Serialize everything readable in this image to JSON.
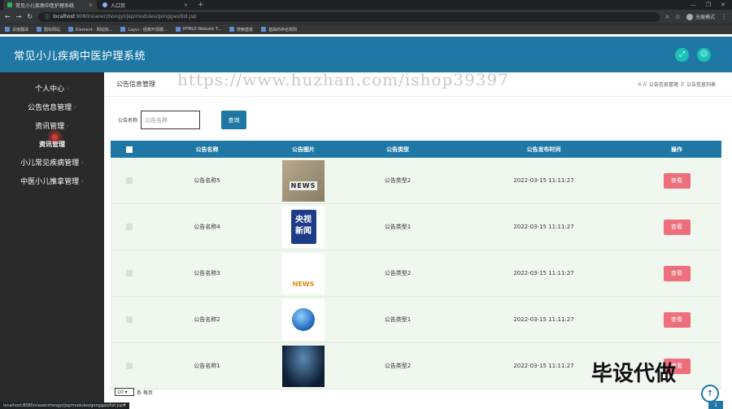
{
  "browser": {
    "tabs": [
      {
        "title": "常见小儿疾病中医护理系统",
        "close": "×"
      },
      {
        "title": "入口页",
        "close": "×"
      }
    ],
    "new_tab": "+",
    "url_host": "localhost",
    "url_path": ":8080/xiaoerzhongyi/jsp/modules/gonggao/list.jsp",
    "profile": "无痕模式",
    "bookmarks": [
      "百度翻译",
      "图标网站",
      "Element - 网站快...",
      "Layui - 经典开源模...",
      "HTML5 Website T...",
      "搜索壁纸",
      "基础的命名规则"
    ],
    "status_url": "localhost:8080/xiaoerzhongyi/jsp/modules/gonggao/list.jsp#"
  },
  "app": {
    "title": "常见小儿疾病中医护理系统",
    "header_icons": [
      "fullscreen-icon",
      "user-icon"
    ]
  },
  "sidebar": {
    "items": [
      {
        "label": "个人中心",
        "caret": "›"
      },
      {
        "label": "公告信息管理",
        "caret": "›"
      },
      {
        "label": "资讯管理",
        "caret": "›"
      },
      {
        "label": "资讯管理",
        "sub": true
      },
      {
        "label": "小儿常见疾病管理",
        "caret": "›"
      },
      {
        "label": "中医小儿推拿管理",
        "caret": "›"
      }
    ]
  },
  "main": {
    "page_title": "公告信息管理",
    "breadcrumb": {
      "home_icon": "⌂",
      "sep": "//",
      "level1": "公告信息管理",
      "level2": "公告信息列表"
    },
    "search": {
      "label": "公告名称",
      "placeholder": "公告名称",
      "button": "查询"
    },
    "table": {
      "headers": [
        "公告名称",
        "公告图片",
        "公告类型",
        "公告发布时间",
        "操作"
      ],
      "rows": [
        {
          "name": "公告名称5",
          "image_text": "NEWS",
          "type": "公告类型2",
          "time": "2022-03-15 11:11:27",
          "action": "查看"
        },
        {
          "name": "公告名称4",
          "image_text": "央视 新闻",
          "type": "公告类型1",
          "time": "2022-03-15 11:11:27",
          "action": "查看"
        },
        {
          "name": "公告名称3",
          "image_text": "NEWS",
          "type": "公告类型2",
          "time": "2022-03-15 11:11:27",
          "action": "查看"
        },
        {
          "name": "公告名称2",
          "image_text": "",
          "type": "公告类型1",
          "time": "2022-03-15 11:11:27",
          "action": "查看"
        },
        {
          "name": "公告名称1",
          "image_text": "",
          "type": "公告类型2",
          "time": "2022-03-15 11:11:27",
          "action": "查看"
        }
      ]
    },
    "pager": {
      "page_size": "10",
      "suffix": "条 每页"
    }
  },
  "overlay": {
    "watermark": "https://www.huzhan.com/ishop39397",
    "stamp": "毕设代做",
    "page_badge": "1"
  },
  "colors": {
    "primary": "#1e77a4",
    "danger": "#ee6f7c",
    "sidebar": "#2a2a2a",
    "row": "#eff7ef",
    "accent": "#19c1b8"
  }
}
